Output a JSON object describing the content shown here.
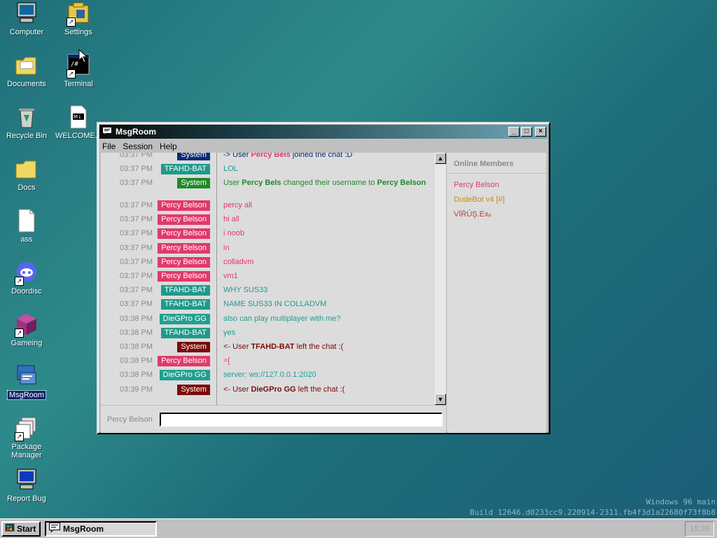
{
  "desktop": {
    "icons": [
      {
        "label": "Computer"
      },
      {
        "label": "Settings"
      },
      {
        "label": "Documents"
      },
      {
        "label": "Terminal"
      },
      {
        "label": "Recycle Bin"
      },
      {
        "label": "WELCOME..."
      },
      {
        "label": "Docs"
      },
      {
        "label": "ass"
      },
      {
        "label": "Doordisc"
      },
      {
        "label": "Gameing"
      },
      {
        "label": "MsgRoom"
      },
      {
        "label": "Package Manager"
      },
      {
        "label": "Report Bug"
      }
    ]
  },
  "window": {
    "title": "MsgRoom",
    "minimize": "_",
    "maximize": "□",
    "close": "×",
    "menu": [
      "File",
      "Session",
      "Help"
    ]
  },
  "chat": {
    "messages": [
      {
        "time": "03:37 PM",
        "user": "System",
        "parts": [
          "-> User ",
          "Percy Bels",
          " joined the chat :D"
        ]
      },
      {
        "time": "03:37 PM",
        "user": "TFAHD-BAT",
        "parts": [
          "LOL"
        ]
      },
      {
        "time": "03:37 PM",
        "user": "System",
        "parts": [
          "User ",
          "Percy Bels",
          " changed their username to ",
          "Percy Belson"
        ]
      },
      {
        "time": "03:37 PM",
        "user": "Percy Belson",
        "parts": [
          "percy all"
        ]
      },
      {
        "time": "03:37 PM",
        "user": "Percy Belson",
        "parts": [
          "hi all"
        ]
      },
      {
        "time": "03:37 PM",
        "user": "Percy Belson",
        "parts": [
          "i noob"
        ]
      },
      {
        "time": "03:37 PM",
        "user": "Percy Belson",
        "parts": [
          "in"
        ]
      },
      {
        "time": "03:37 PM",
        "user": "Percy Belson",
        "parts": [
          "colladvm"
        ]
      },
      {
        "time": "03:37 PM",
        "user": "Percy Belson",
        "parts": [
          "vm1"
        ]
      },
      {
        "time": "03:37 PM",
        "user": "TFAHD-BAT",
        "parts": [
          "WHY SUS33"
        ]
      },
      {
        "time": "03:37 PM",
        "user": "TFAHD-BAT",
        "parts": [
          "NAME SUS33 IN COLLADVM"
        ]
      },
      {
        "time": "03:38 PM",
        "user": "DieGPro GG",
        "parts": [
          "also can play multiplayer with me?"
        ]
      },
      {
        "time": "03:38 PM",
        "user": "TFAHD-BAT",
        "parts": [
          "yes"
        ]
      },
      {
        "time": "03:38 PM",
        "user": "System",
        "parts": [
          "<- User ",
          "TFAHD-BAT",
          " left the chat :("
        ]
      },
      {
        "time": "03:38 PM",
        "user": "Percy Belson",
        "parts": [
          "=["
        ]
      },
      {
        "time": "03:38 PM",
        "user": "DieGPro GG",
        "parts": [
          "server: ws://127.0.0.1:2020"
        ]
      },
      {
        "time": "03:39 PM",
        "user": "System",
        "parts": [
          "<- User ",
          "DieGPro GG",
          " left the chat :("
        ]
      }
    ]
  },
  "colors": {
    "system_join": "#0a2a7a",
    "system_rename": "#1f8a2a",
    "system_leave": "#7a0a0a",
    "tfahd": "#1f9a8a",
    "percy": "#e03a6a",
    "diegpro": "#1fa090"
  },
  "members": {
    "heading": "Online Members",
    "list": [
      {
        "name": "Percy Belson",
        "color": "#e03a6a"
      },
      {
        "name": "DudeBot v4 [#]",
        "color": "#c09020"
      },
      {
        "name": "VĪŔŪŞ.Exₑ",
        "color": "#b04040"
      }
    ]
  },
  "input": {
    "username": "Percy Belson",
    "value": ""
  },
  "taskbar": {
    "start": "Start",
    "task": "MsgRoom",
    "clock": "15:39"
  },
  "build": {
    "line1": "Windows 96 main",
    "line2": "Build 12646.d0233cc9.220914-2311.fb4f3d1a22680f73f8b8"
  }
}
